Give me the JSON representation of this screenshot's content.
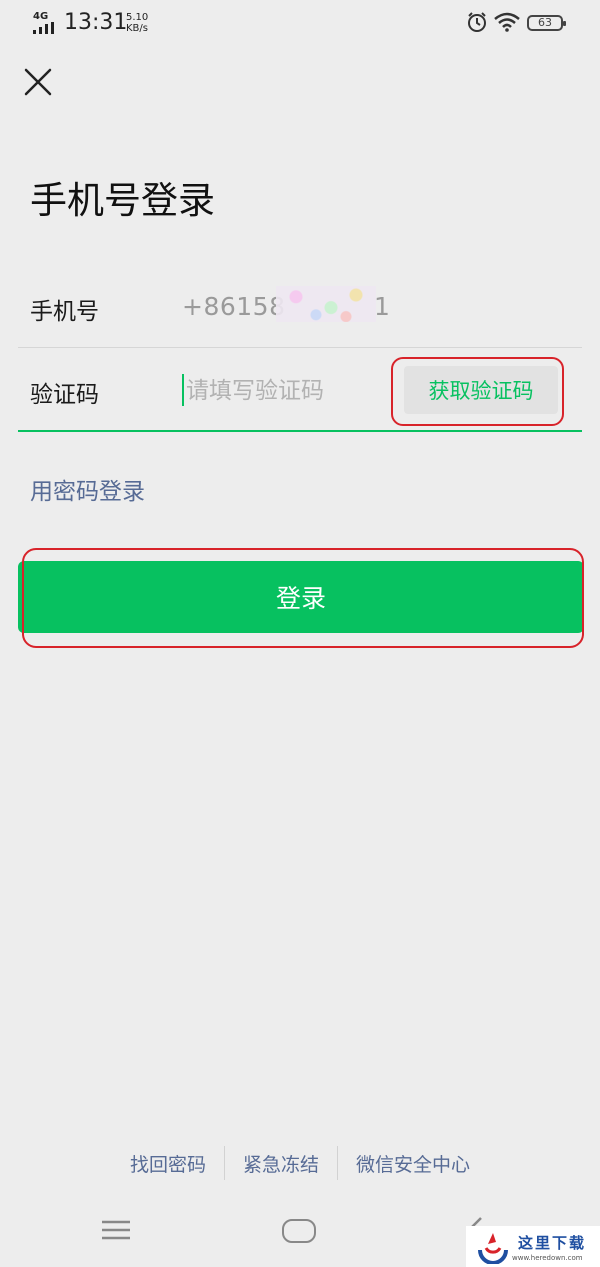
{
  "status_bar": {
    "network": "4G",
    "time": "13:31",
    "speed_value": "5.10",
    "speed_unit": "KB/s",
    "battery": "63"
  },
  "header": {
    "close_icon": "close-icon",
    "title": "手机号登录"
  },
  "phone_row": {
    "label": "手机号",
    "value_prefix": "+86158",
    "value_suffix": "1"
  },
  "code_row": {
    "label": "验证码",
    "placeholder": "请填写验证码",
    "get_code_label": "获取验证码"
  },
  "password_login_link": "用密码登录",
  "login_button": "登录",
  "footer": {
    "links": [
      "找回密码",
      "紧急冻结",
      "微信安全中心"
    ]
  },
  "watermark": {
    "title": "这里下载",
    "url": "www.heredown.com"
  },
  "colors": {
    "accent": "#07c160",
    "link": "#576b95",
    "annotation": "#d8232a",
    "background": "#ededed"
  }
}
